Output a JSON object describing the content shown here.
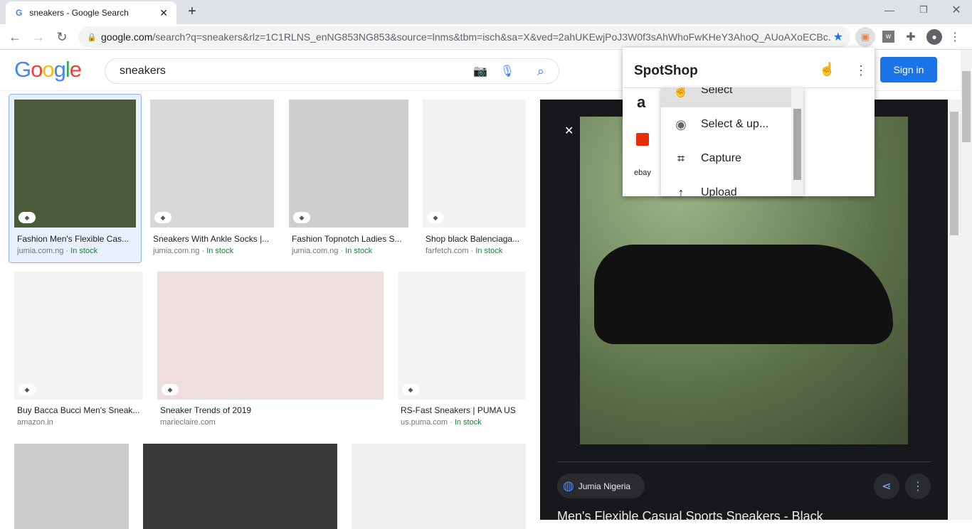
{
  "browser": {
    "tab_title": "sneakers - Google Search",
    "url_domain": "google.com",
    "url_path": "/search?q=sneakers&rlz=1C1RLNS_enNG853NG853&source=lnms&tbm=isch&sa=X&ved=2ahUKEwjPoJ3W0f3sAhWhoFwKHeY3AhoQ_AUoAXoECBc..."
  },
  "search": {
    "query": "sneakers",
    "sign_in": "Sign in",
    "logo": "Google"
  },
  "results": [
    {
      "title": "Fashion Men's Flexible Cas...",
      "source": "jumia.com.ng",
      "stock": "In stock",
      "color": "#4a5a3a"
    },
    {
      "title": "Sneakers With Ankle Socks |...",
      "source": "jumia.com.ng",
      "stock": "In stock",
      "color": "#d8d8d8"
    },
    {
      "title": "Fashion Topnotch Ladies S...",
      "source": "jumia.com.ng",
      "stock": "In stock",
      "color": "#cfcfcf"
    },
    {
      "title": "Shop black Balenciaga...",
      "source": "farfetch.com",
      "stock": "In stock",
      "color": "#f2f2f2"
    },
    {
      "title": "Buy Bacca Bucci Men's Sneak...",
      "source": "amazon.in",
      "stock": "",
      "color": "#f4f4f4"
    },
    {
      "title": "Sneaker Trends of 2019",
      "source": "marieclaire.com",
      "stock": "",
      "color": "#efdede"
    },
    {
      "title": "RS-Fast Sneakers | PUMA US",
      "source": "us.puma.com",
      "stock": "In stock",
      "color": "#f3f3f3"
    },
    {
      "title": "",
      "source": "",
      "stock": "",
      "color": "#cccccc"
    },
    {
      "title": "",
      "source": "",
      "stock": "",
      "color": "#3a3a3a"
    },
    {
      "title": "",
      "source": "",
      "stock": "",
      "color": "#f0f0f0"
    }
  ],
  "preview": {
    "site": "Jumia Nigeria",
    "title": "Men's Flexible Casual Sports Sneakers - Black"
  },
  "spotshop": {
    "title": "SpotShop",
    "stores": [
      "a",
      "ebay"
    ],
    "menu": [
      "Select",
      "Select & up...",
      "Capture",
      "Upload"
    ]
  }
}
